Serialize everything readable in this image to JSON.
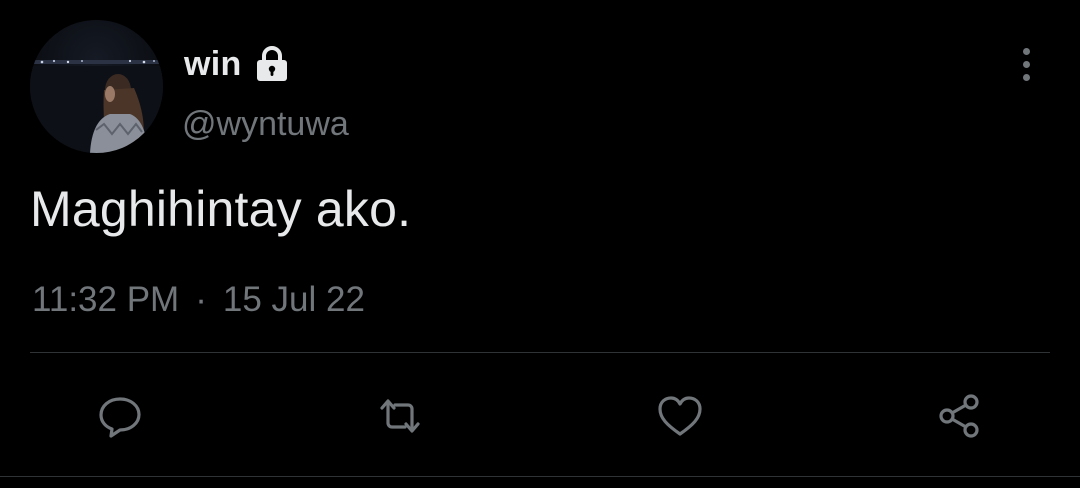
{
  "author": {
    "display_name": "win",
    "handle": "@wyntuwa",
    "protected_icon": "lock-icon"
  },
  "tweet": {
    "text": "Maghihintay ako.",
    "time": "11:32 PM",
    "separator": "·",
    "date": "15 Jul 22"
  },
  "actions": [
    {
      "name": "reply",
      "icon": "speech-bubble-icon"
    },
    {
      "name": "retweet",
      "icon": "retweet-arrows-icon"
    },
    {
      "name": "like",
      "icon": "heart-icon"
    },
    {
      "name": "share",
      "icon": "share-nodes-icon"
    }
  ],
  "menu": {
    "icon": "vertical-ellipsis-icon"
  },
  "colors": {
    "background": "#000000",
    "primary_text": "#e7e9ea",
    "secondary_text": "#71767b",
    "divider": "#2f3336"
  }
}
